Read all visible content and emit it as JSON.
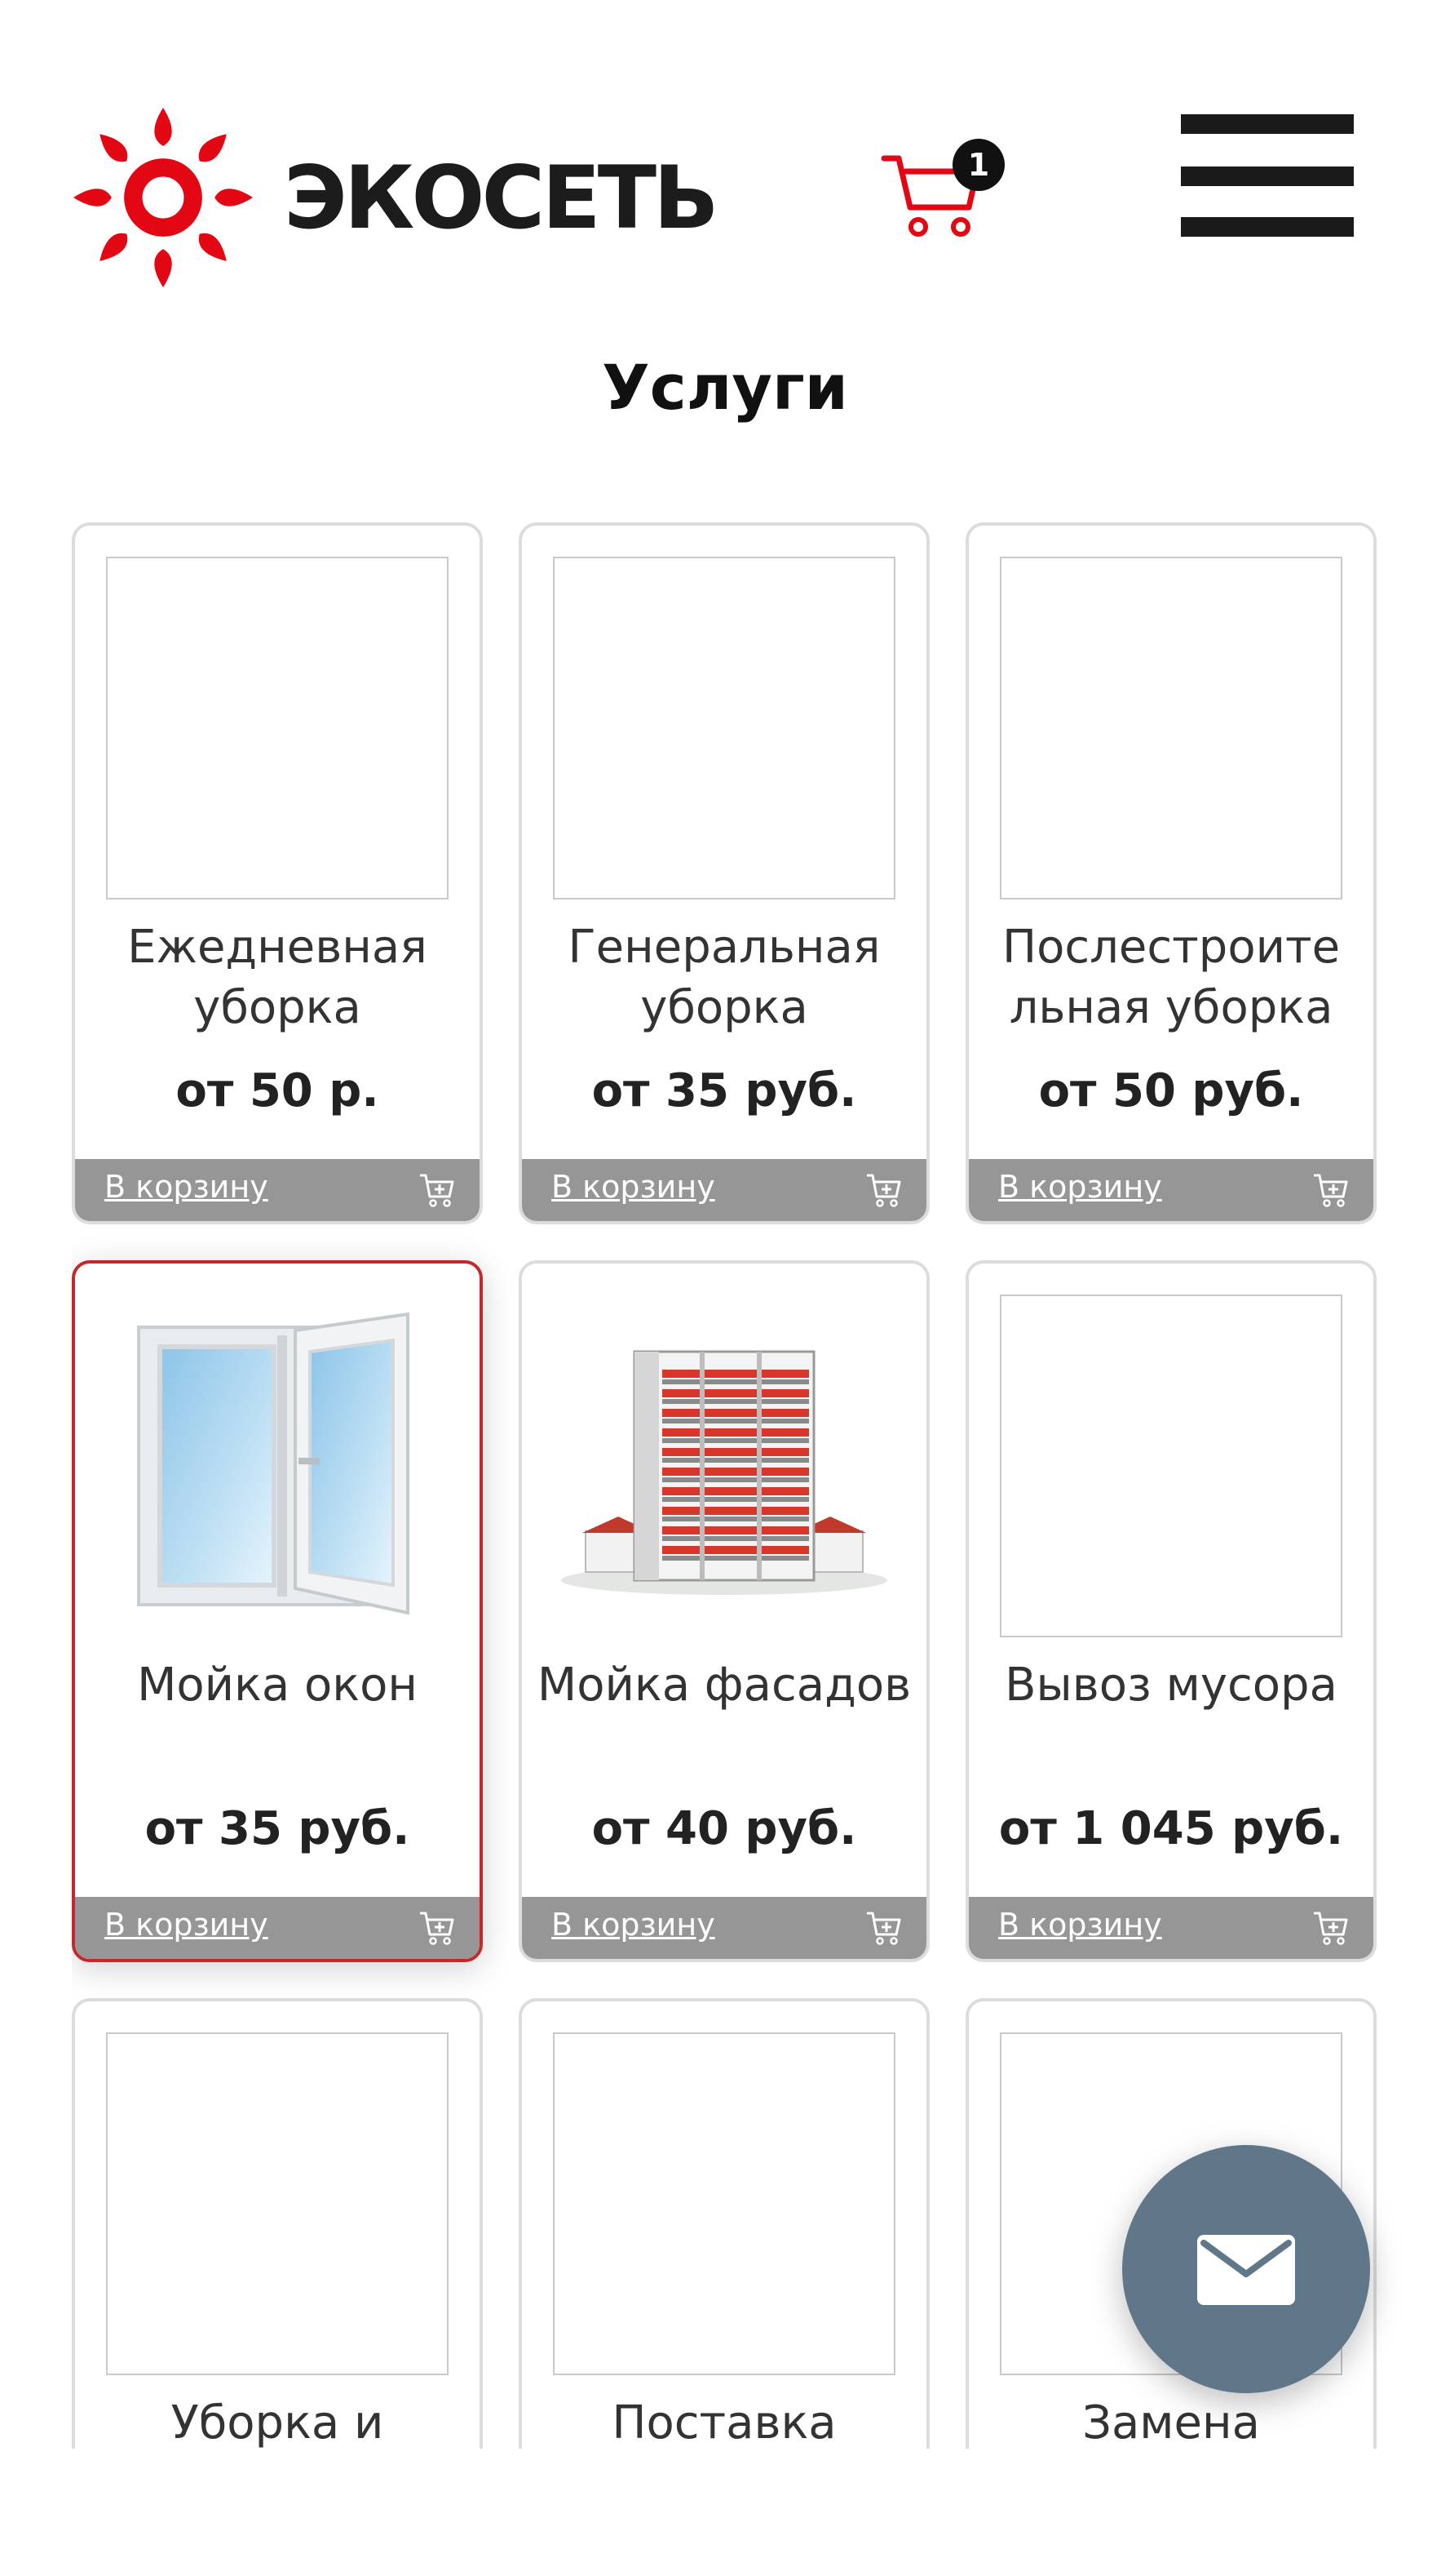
{
  "header": {
    "logo_text": "ЭКОСЕТЬ",
    "cart_count": "1"
  },
  "page": {
    "title": "Услуги"
  },
  "colors": {
    "brand_red": "#e30613",
    "footer_gray": "#969696",
    "fab": "#5f7788"
  },
  "cards": [
    {
      "title": "Ежедневная уборка",
      "price": "от 50 р.",
      "cart_link": "В корзину"
    },
    {
      "title": "Генеральная уборка",
      "price": "от 35 руб.",
      "cart_link": "В корзину"
    },
    {
      "title": "Послестроите льная уборка",
      "price": "от 50 руб.",
      "cart_link": "В корзину"
    },
    {
      "title": "Мойка окон",
      "price": "от 35 руб.",
      "cart_link": "В корзину",
      "image": "window-icon"
    },
    {
      "title": "Мойка фасадов",
      "price": "от 40 руб.",
      "cart_link": "В корзину",
      "image": "building-icon"
    },
    {
      "title": "Вывоз мусора",
      "price": "от 1 045 руб.",
      "cart_link": "В корзину"
    },
    {
      "title": "Уборка и",
      "price": "",
      "cart_link": ""
    },
    {
      "title": "Поставка",
      "price": "",
      "cart_link": ""
    },
    {
      "title": "Замена",
      "price": "",
      "cart_link": ""
    }
  ],
  "fab": {
    "icon": "mail-icon"
  }
}
